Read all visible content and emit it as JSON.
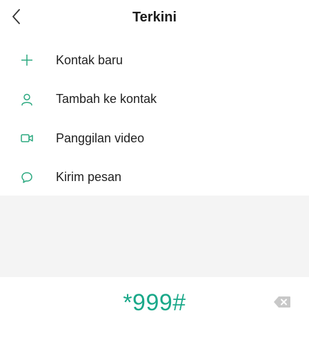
{
  "header": {
    "title": "Terkini",
    "back_icon": "chevron-left-icon"
  },
  "menu": {
    "items": [
      {
        "label": "Kontak baru",
        "icon": "plus-icon"
      },
      {
        "label": "Tambah ke kontak",
        "icon": "person-icon"
      },
      {
        "label": "Panggilan video",
        "icon": "video-camera-icon"
      },
      {
        "label": "Kirim pesan",
        "icon": "chat-bubble-icon"
      }
    ]
  },
  "dialer": {
    "number": "*999#",
    "backspace_icon": "backspace-icon"
  },
  "colors": {
    "accent": "#1aa889",
    "icon_green": "#2aa87f",
    "background_gray": "#f4f4f4"
  }
}
